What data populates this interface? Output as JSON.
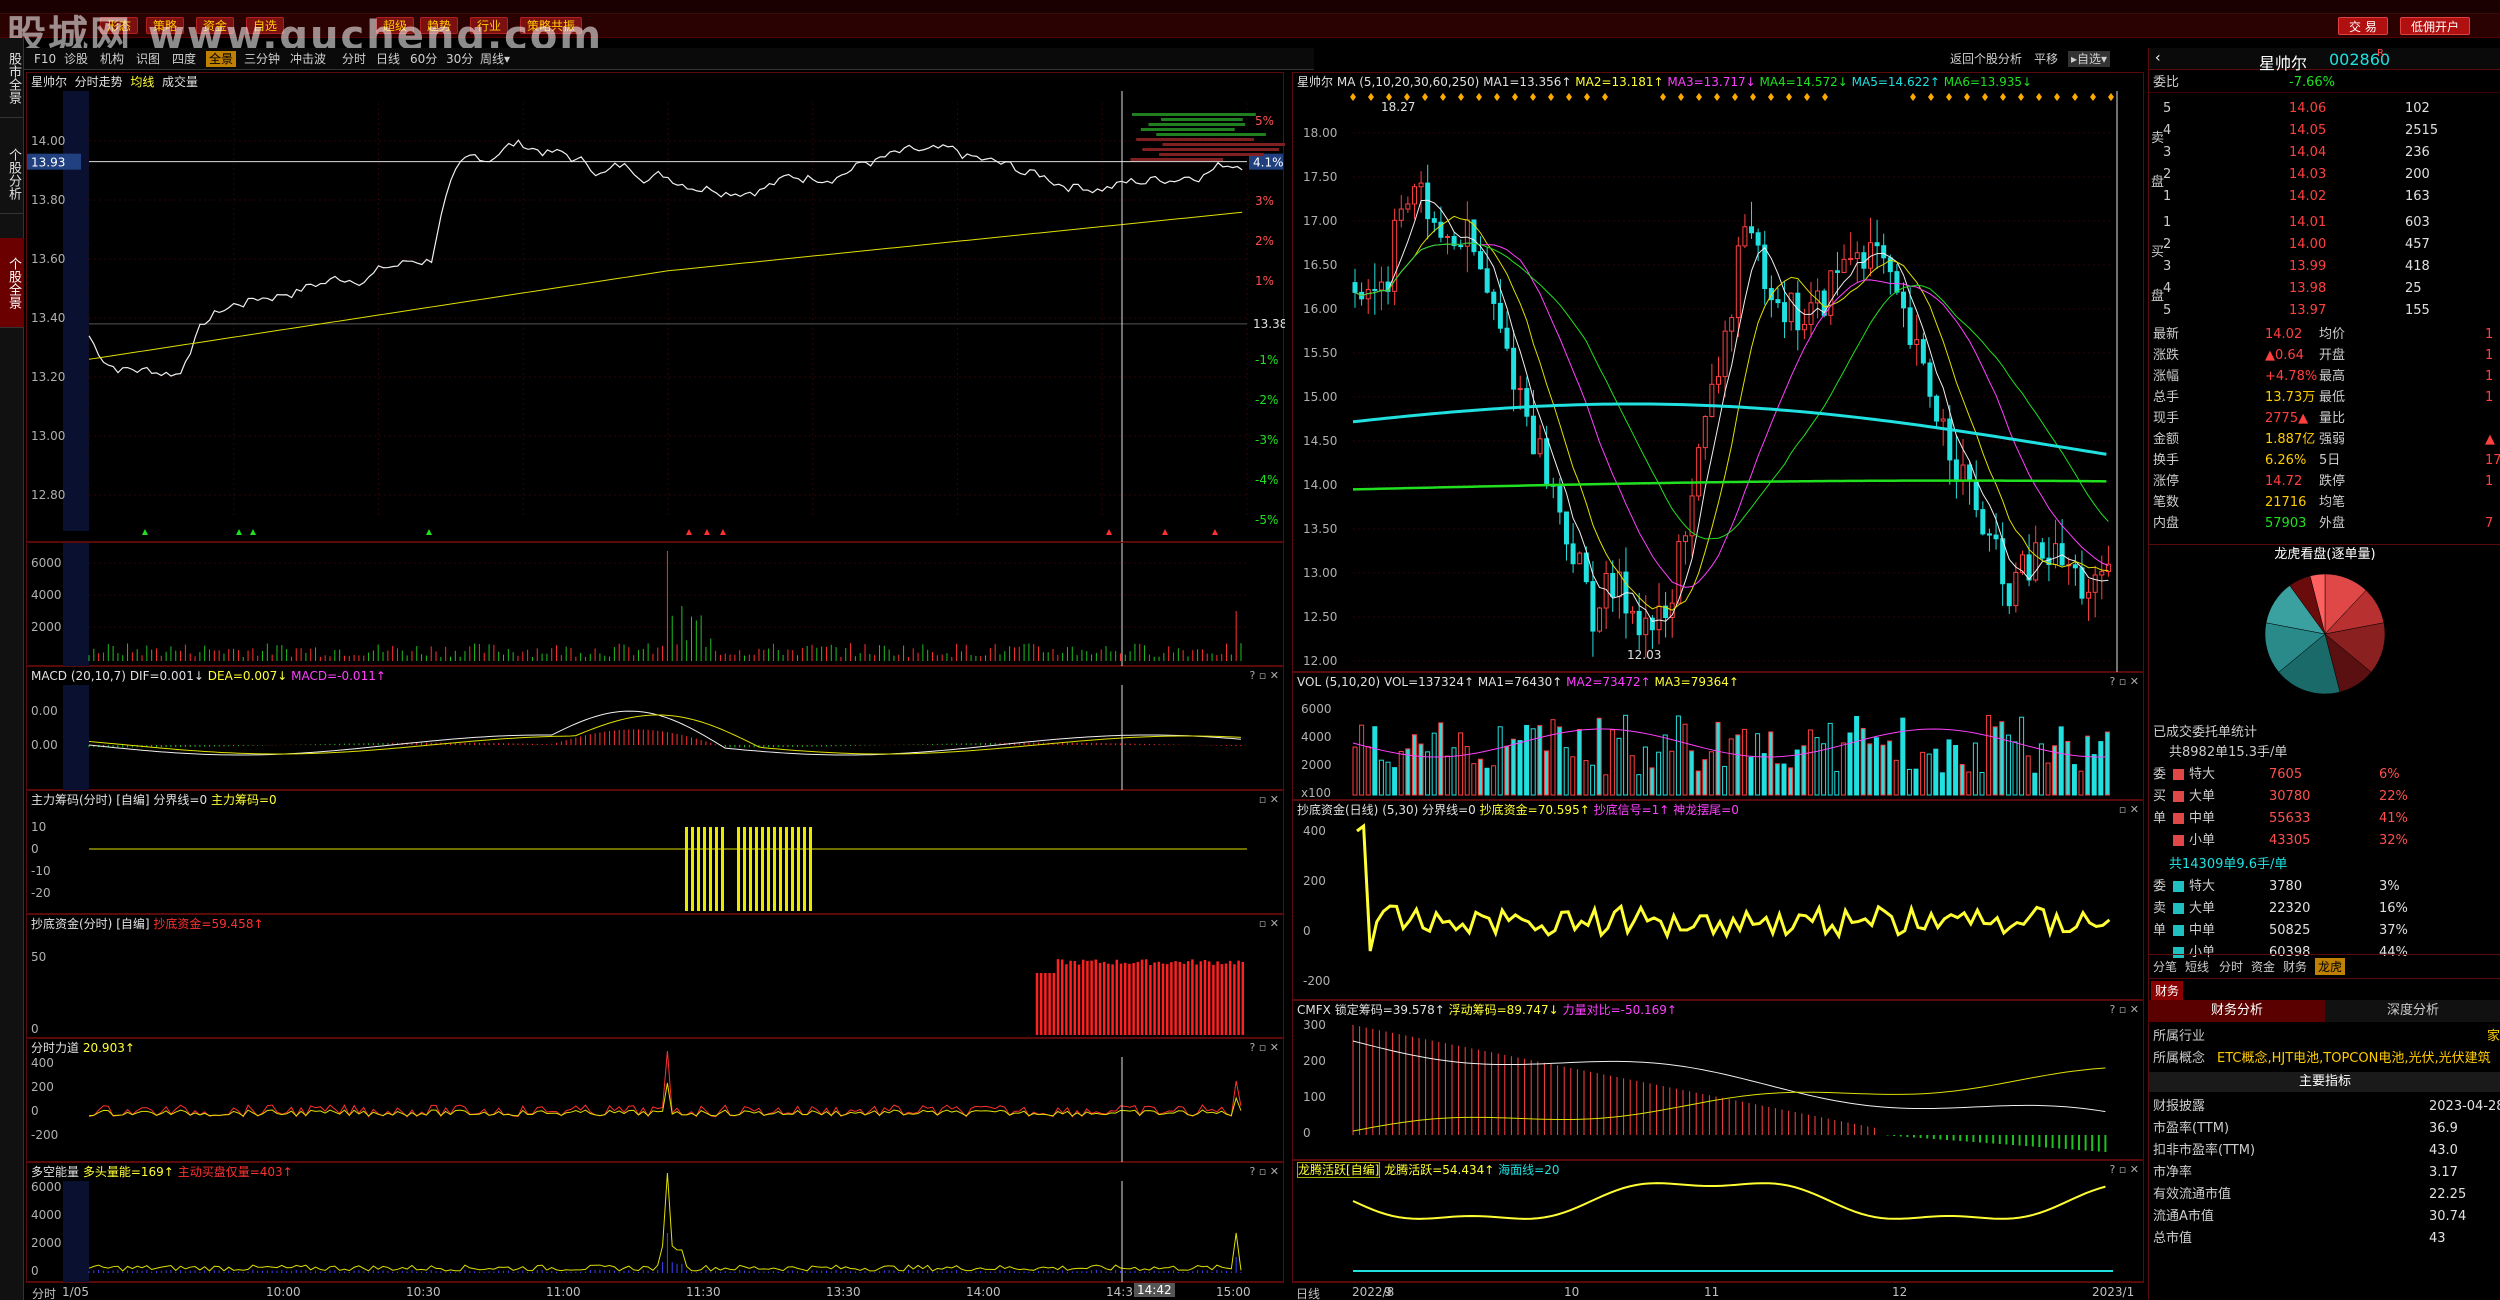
{
  "ribbon": {
    "buttons": [
      "形态",
      "策略",
      "资金",
      "自选",
      "超级",
      "趋势",
      "行业",
      "策略共振"
    ],
    "trade": "交 易",
    "margin": "低佣开户"
  },
  "watermark": "股城网 www.gucheng.com",
  "vtabs": [
    "股市全景",
    "个股分析",
    "个股全景"
  ],
  "toolbar": {
    "items": [
      "F10",
      "诊股",
      "机构",
      "识图",
      "四度",
      "全景",
      "三分钟",
      "冲击波",
      "分时",
      "日线",
      "60分",
      "30分",
      "周线▾"
    ],
    "active": "全景"
  },
  "rtool": {
    "back": "返回个股分析",
    "flat": "平移",
    "custom": "▸自选▾"
  },
  "intraday": {
    "header": [
      "星帅尔",
      "分时走势",
      "均线",
      "成交量"
    ],
    "price_ticks": [
      "14.00",
      "13.80",
      "13.60",
      "13.40",
      "13.20",
      "13.00",
      "12.80"
    ],
    "current_price": "13.93",
    "base_price": "13.38",
    "pct_ticks": [
      "5%",
      "4%",
      "3%",
      "2%",
      "1%",
      "-1%",
      "-2%",
      "-3%",
      "-4%",
      "-5%"
    ],
    "pct_current": "4.1%",
    "vol_ticks": [
      "6000",
      "4000",
      "2000"
    ],
    "macd_head": {
      "name": "MACD",
      "params": "(20,10,7)",
      "dif": "DIF=0.001↓",
      "dea": "DEA=0.007↓",
      "macd": "MACD=-0.011↑"
    },
    "macd_ticks": [
      "0.00",
      "0.00"
    ],
    "zhuli_head": {
      "name": "主力筹码(分时)",
      "ext": "[自编]",
      "line": "分界线=0",
      "val": "主力筹码=0"
    },
    "zhuli_ticks": [
      "10",
      "0",
      "-10",
      "-20"
    ],
    "chaodi_head": {
      "name": "抄底资金(分时)",
      "ext": "[自编]",
      "val": "抄底资金=59.458↑"
    },
    "chaodi_ticks": [
      "50",
      "0"
    ],
    "lidao_head": {
      "name": "分时力道",
      "val": "20.903↑"
    },
    "lidao_ticks": [
      "400",
      "200",
      "0",
      "-200"
    ],
    "duokong_head": {
      "name": "多空能量",
      "v1": "多头量能=169↑",
      "v2": "主动买盘仅量=403↑"
    },
    "duokong_ticks": [
      "6000",
      "4000",
      "2000",
      "0"
    ],
    "time_axis": [
      "1/05",
      "10:00",
      "10:30",
      "11:00",
      "11:30",
      "13:30",
      "14:00",
      "14:30",
      "15:00"
    ],
    "cursor_time": "14:42",
    "footer": "分时"
  },
  "kline": {
    "header": {
      "name": "星帅尔",
      "ma": "MA",
      "params": "(5,10,20,30,60,250)",
      "ma1": "MA1=13.356↑",
      "ma2": "MA2=13.181↑",
      "ma3": "MA3=13.717↓",
      "ma4": "MA4=14.572↓",
      "ma5": "MA5=14.622↑",
      "ma6": "MA6=13.935↓"
    },
    "price_ticks": [
      "18.00",
      "17.50",
      "17.00",
      "16.50",
      "16.00",
      "15.50",
      "15.00",
      "14.50",
      "14.00",
      "13.50",
      "13.00",
      "12.50",
      "12.00"
    ],
    "high_label": "18.27",
    "low_label": "12.03",
    "vol_head": {
      "name": "VOL",
      "params": "(5,10,20)",
      "vol": "VOL=137324↑",
      "ma1": "MA1=76430↑",
      "ma2": "MA2=73472↑",
      "ma3": "MA3=79364↑"
    },
    "vol_ticks": [
      "6000",
      "4000",
      "2000",
      "x100"
    ],
    "chaodi_head": {
      "name": "抄底资金(日线)",
      "ext": "[自编]",
      "params": "(5,30)",
      "line": "分界线=0",
      "val": "抄底资金=70.595↑",
      "sig": "抄底信号=1↑",
      "sl": "神龙摆尾=0"
    },
    "chaodi_ticks": [
      "400",
      "200",
      "0",
      "-200"
    ],
    "cmfx_head": {
      "name": "CMFX",
      "a": "锁定筹码=39.578↑",
      "b": "浮动筹码=89.747↓",
      "c": "力量对比=-50.169↑"
    },
    "cmfx_ticks": [
      "300",
      "200",
      "100",
      "0"
    ],
    "long_head": {
      "name": "龙腾活跃[自编]",
      "val": "龙腾活跃=54.434↑",
      "sea": "海面线=20"
    },
    "date_axis": [
      "2022/8",
      "9",
      "10",
      "11",
      "12",
      "2023/1"
    ],
    "footer": "日线"
  },
  "quote": {
    "name": "星帅尔",
    "code": "002860",
    "weibi_label": "委比",
    "weibi": "-7.66%",
    "sells": [
      {
        "lv": "5",
        "p": "14.06",
        "v": "102"
      },
      {
        "lv": "4",
        "p": "14.05",
        "v": "2515"
      },
      {
        "lv": "3",
        "p": "14.04",
        "v": "236"
      },
      {
        "lv": "2",
        "p": "14.03",
        "v": "200"
      },
      {
        "lv": "1",
        "p": "14.02",
        "v": "163"
      }
    ],
    "buys": [
      {
        "lv": "1",
        "p": "14.01",
        "v": "603"
      },
      {
        "lv": "2",
        "p": "14.00",
        "v": "457"
      },
      {
        "lv": "3",
        "p": "13.99",
        "v": "418"
      },
      {
        "lv": "4",
        "p": "13.98",
        "v": "25"
      },
      {
        "lv": "5",
        "p": "13.97",
        "v": "155"
      }
    ],
    "side_labels": {
      "sell1": "卖",
      "sell2": "盘",
      "buy1": "买",
      "buy2": "盘"
    },
    "stats": [
      {
        "k": "最新",
        "v": "14.02",
        "k2": "均价",
        "v2": "1"
      },
      {
        "k": "涨跌",
        "v": "▲0.64",
        "k2": "开盘",
        "v2": "1"
      },
      {
        "k": "涨幅",
        "v": "+4.78%",
        "k2": "最高",
        "v2": "1"
      },
      {
        "k": "总手",
        "v": "13.73万",
        "k2": "最低",
        "v2": "1"
      },
      {
        "k": "现手",
        "v": "2775▲",
        "k2": "量比",
        "v2": ""
      },
      {
        "k": "金额",
        "v": "1.887亿",
        "k2": "强弱",
        "v2": "▲"
      },
      {
        "k": "换手",
        "v": "6.26%",
        "k2": "5日",
        "v2": "17."
      },
      {
        "k": "涨停",
        "v": "14.72",
        "k2": "跌停",
        "v2": "1"
      },
      {
        "k": "笔数",
        "v": "21716",
        "k2": "均笔",
        "v2": ""
      },
      {
        "k": "内盘",
        "v": "57903",
        "k2": "外盘",
        "v2": "7"
      }
    ],
    "pie_title": "龙虎看盘(逐单量)",
    "pie_slices": [
      {
        "v": 12,
        "c": "#e04848"
      },
      {
        "v": 10,
        "c": "#b83030"
      },
      {
        "v": 14,
        "c": "#8a2020"
      },
      {
        "v": 10,
        "c": "#5a1010"
      },
      {
        "v": 18,
        "c": "#1a6a6a"
      },
      {
        "v": 14,
        "c": "#2a8a8a"
      },
      {
        "v": 12,
        "c": "#3aa0a0"
      },
      {
        "v": 6,
        "c": "#6a0c0c"
      },
      {
        "v": 4,
        "c": "#ff6060"
      }
    ],
    "order_title": "已成交委托单统计",
    "buy_total": "共8982单15.3手/单",
    "buy_orders": [
      {
        "k": "特大",
        "v": "7605",
        "p": "6%"
      },
      {
        "k": "大单",
        "v": "30780",
        "p": "22%"
      },
      {
        "k": "中单",
        "v": "55633",
        "p": "41%"
      },
      {
        "k": "小单",
        "v": "43305",
        "p": "32%"
      }
    ],
    "sell_total": "共14309单9.6手/单",
    "sell_orders": [
      {
        "k": "特大",
        "v": "3780",
        "p": "3%"
      },
      {
        "k": "大单",
        "v": "22320",
        "p": "16%"
      },
      {
        "k": "中单",
        "v": "50825",
        "p": "37%"
      },
      {
        "k": "小单",
        "v": "60398",
        "p": "44%"
      }
    ],
    "side_chars_a": [
      "委",
      "买",
      "单"
    ],
    "side_chars_b": [
      "委",
      "卖",
      "单"
    ],
    "tabs": [
      "分笔",
      "短线",
      "分时",
      "资金",
      "财务",
      "龙虎"
    ],
    "tab_active": "龙虎",
    "fin_tab": "财务",
    "fin_head": "财务分析",
    "fin_head2": "深度分析",
    "industry_k": "所属行业",
    "industry_v": "家",
    "concept_k": "所属概念",
    "concept_v": "ETC概念,HJT电池,TOPCON电池,光伏,光伏建筑",
    "key_head": "主要指标",
    "metrics": [
      {
        "k": "财报披露",
        "v": "2023-04-28"
      },
      {
        "k": "市盈率(TTM)",
        "v": "36.9"
      },
      {
        "k": "扣非市盈率(TTM)",
        "v": "43.0"
      },
      {
        "k": "市净率",
        "v": "3.17"
      },
      {
        "k": "有效流通市值",
        "v": "22.25"
      },
      {
        "k": "流通A市值",
        "v": "30.74"
      },
      {
        "k": "总市值",
        "v": "43"
      }
    ]
  }
}
